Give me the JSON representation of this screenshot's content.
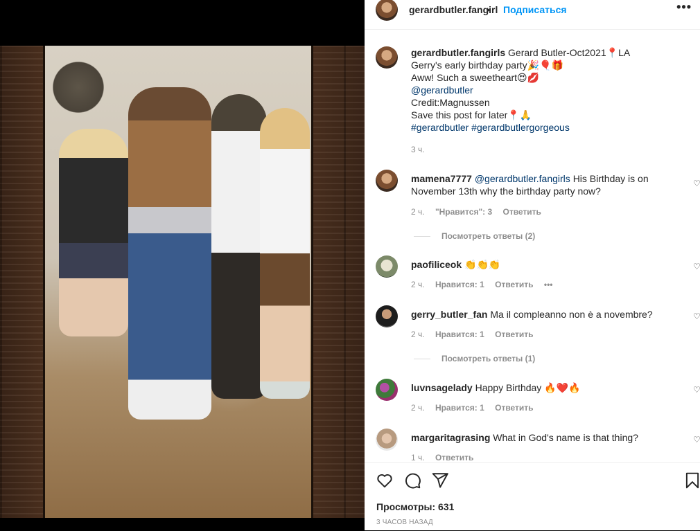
{
  "header": {
    "username": "gerardbutler.fangirl",
    "separator": "•",
    "follow_label": "Подписаться",
    "more_label": "•••"
  },
  "caption": {
    "username": "gerardbutler.fangirls",
    "lines": [
      "Gerard Butler-Oct2021📍LA",
      "Gerry's early birthday party🎉🎈🎁",
      "Aww! Such a sweetheart😍💋",
      "@gerardbutler",
      "Credit:Magnussen",
      "Save this post for later📍🙏",
      "#gerardbutler #gerardbutlergorgeous"
    ],
    "time": "3 ч."
  },
  "comments": [
    {
      "username": "mamena7777",
      "mention": "@gerardbutler.fangirls",
      "text": "His Birthday is on November 13th why the birthday party now?",
      "time": "2 ч.",
      "likes": "\"Нравится\": 3",
      "reply_label": "Ответить",
      "view_replies": "Посмотреть ответы (2)"
    },
    {
      "username": "paofiliceok",
      "text": "👏👏👏",
      "time": "2 ч.",
      "likes": "Нравится: 1",
      "reply_label": "Ответить",
      "more": "•••"
    },
    {
      "username": "gerry_butler_fan",
      "text": "Ma il compleanno non è a novembre?",
      "time": "2 ч.",
      "likes": "Нравится: 1",
      "reply_label": "Ответить",
      "view_replies": "Посмотреть ответы (1)"
    },
    {
      "username": "luvnsagelady",
      "text": "Happy Birthday 🔥❤️🔥",
      "time": "2 ч.",
      "likes": "Нравится: 1",
      "reply_label": "Ответить"
    },
    {
      "username": "margaritagrasing",
      "text": "What in God's name is that thing?",
      "time": "1 ч.",
      "reply_label": "Ответить"
    }
  ],
  "footer": {
    "views_label": "Просмотры: 631",
    "timestamp": "3 ЧАСОВ НАЗАД"
  },
  "icons": {
    "like": "heart-icon",
    "comment": "comment-icon",
    "share": "share-icon",
    "save": "bookmark-icon"
  },
  "colors": {
    "link": "#0095f6",
    "mention": "#00376b",
    "muted": "#8e8e8e"
  }
}
